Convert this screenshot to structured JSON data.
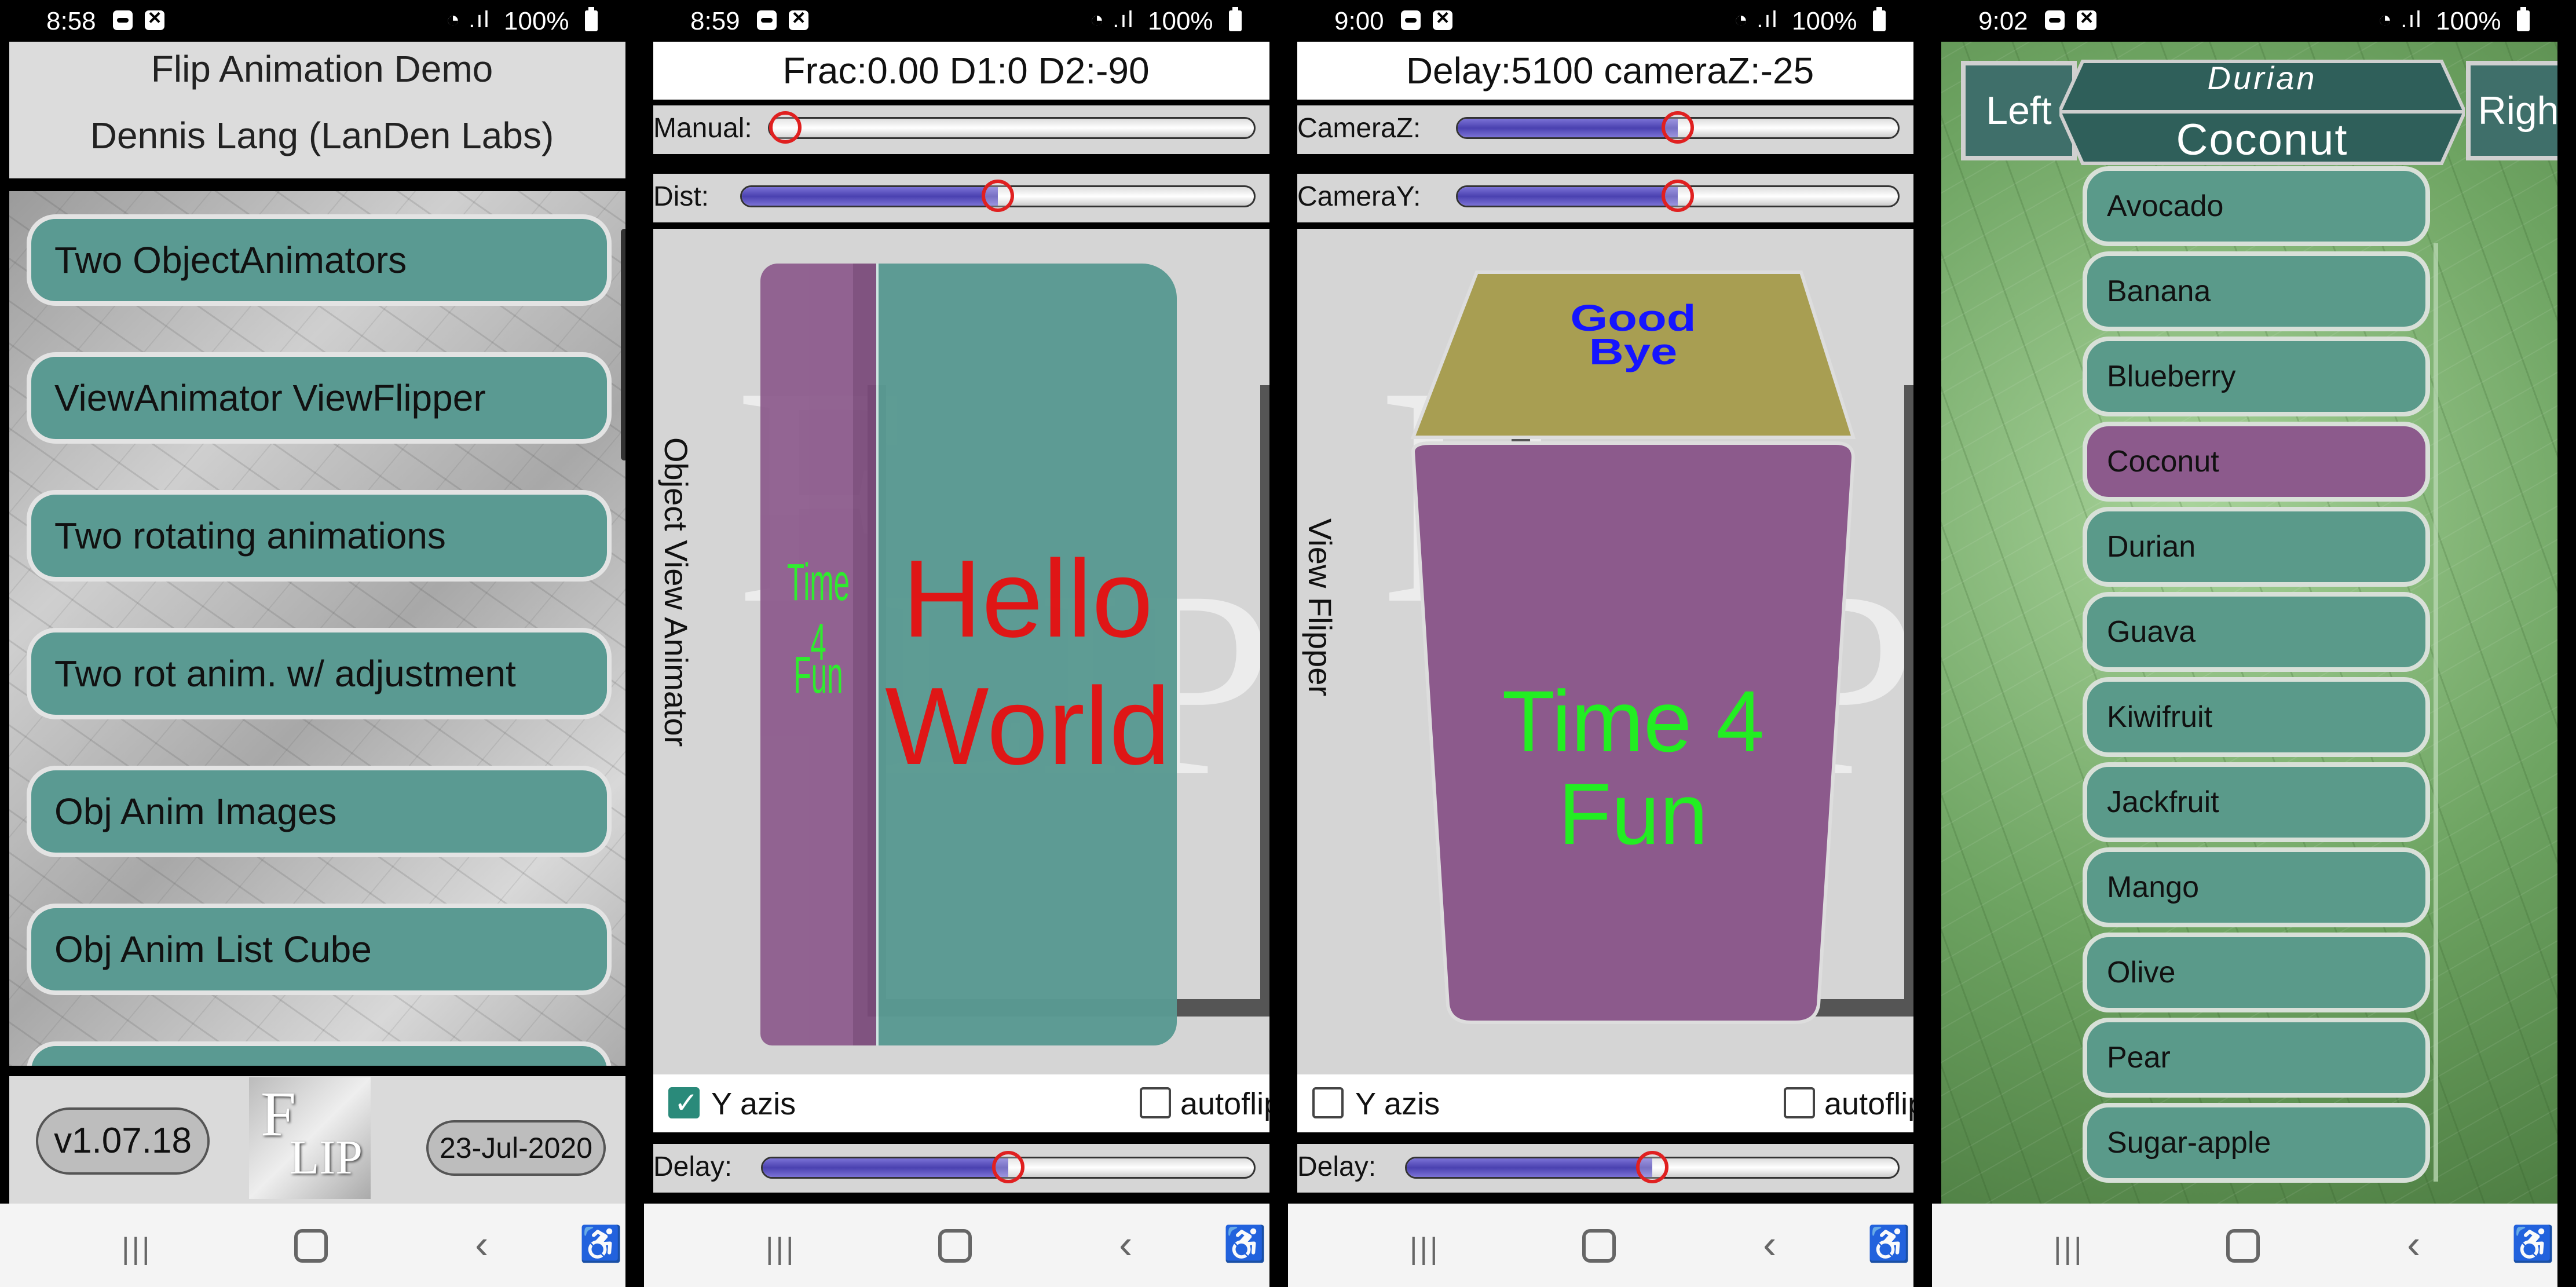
{
  "phones": [
    {
      "time": "8:58",
      "battery": "100%"
    },
    {
      "time": "8:59",
      "battery": "100%"
    },
    {
      "time": "9:00",
      "battery": "100%"
    },
    {
      "time": "9:02",
      "battery": "100%"
    }
  ],
  "menu": {
    "title": "Flip Animation Demo",
    "author": "Dennis Lang (LanDen Labs)",
    "items": [
      "Two ObjectAnimators",
      "ViewAnimator ViewFlipper",
      "Two rotating animations",
      "Two rot anim. w/ adjustment",
      "Obj Anim Images",
      "Obj Anim List Cube"
    ],
    "version": "v1.07.18",
    "date": "23-Jul-2020",
    "logo_top": "F",
    "logo_bottom": "LIP"
  },
  "objanim": {
    "header": "Frac:0.00  D1:0  D2:-90",
    "manual_label": "Manual:",
    "dist_label": "Dist:",
    "side_label": "Object View Animator",
    "back_text_1": "Time 4",
    "back_text_2": "Fun",
    "front_text_1": "Hello",
    "front_text_2": "World",
    "yazis_label": "Y azis",
    "autoflip_label": "autoflip",
    "delay_label": "Delay:",
    "manual_value": 0.0,
    "dist_value": 0.5,
    "delay_value": 0.5,
    "yazis_checked": true,
    "autoflip_checked": false
  },
  "flipper": {
    "header": "Delay:5100  cameraZ:-25",
    "cameraz_label": "CameraZ:",
    "cameray_label": "CameraY:",
    "side_label": "View Flipper",
    "top_text_1": "Good",
    "top_text_2": "Bye",
    "face_text_1": "Time 4",
    "face_text_2": "Fun",
    "yazis_label": "Y azis",
    "autoflip_label": "autoflip",
    "delay_label": "Delay:",
    "cameraz_value": 0.5,
    "cameray_value": 0.5,
    "delay_value": 0.5,
    "yazis_checked": false,
    "autoflip_checked": false
  },
  "cube": {
    "left_label": "Left",
    "right_label": "Right",
    "face_top": "Durian",
    "face_front": "Coconut",
    "fruits": [
      "Avocado",
      "Banana",
      "Blueberry",
      "Coconut",
      "Durian",
      "Guava",
      "Kiwifruit",
      "Jackfruit",
      "Mango",
      "Olive",
      "Pear",
      "Sugar-apple"
    ],
    "selected": "Coconut"
  },
  "colors": {
    "teal_button": "#5a9a92",
    "purple_face": "#8c5a8c",
    "red_text": "#e01010",
    "green_text": "#22ee22",
    "slider_fill": "#4a41b0"
  }
}
